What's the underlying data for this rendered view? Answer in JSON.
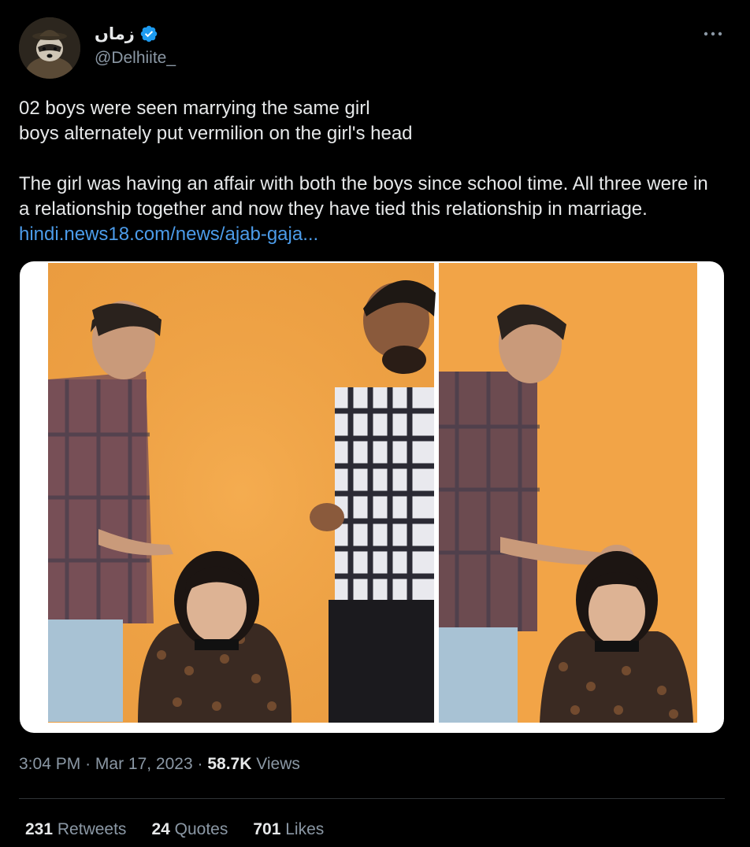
{
  "author": {
    "display_name": "زماں",
    "handle": "@Delhiite_",
    "verified": true,
    "avatar_icon": "raccoon-detective-avatar"
  },
  "tweet": {
    "line1": "02 boys were seen marrying the same girl",
    "line2": "boys alternately put vermilion on the girl's head",
    "para2": "The girl was having an affair with both the boys since school time.  All three were in a relationship together and now they have tied this relationship in marriage.",
    "link_text": "hindi.news18.com/news/ajab-gaja..."
  },
  "meta": {
    "time": "3:04 PM",
    "separator": "·",
    "date": "Mar 17, 2023",
    "views_count": "58.7K",
    "views_label": "Views"
  },
  "stats": {
    "retweets_count": "231",
    "retweets_label": "Retweets",
    "quotes_count": "24",
    "quotes_label": "Quotes",
    "likes_count": "701",
    "likes_label": "Likes"
  },
  "colors": {
    "background": "#000000",
    "text": "#e7e9ea",
    "secondary": "#8b98a5",
    "link": "#4c9cea",
    "verified": "#1d9bf0",
    "photo_backdrop": "#f2a447"
  }
}
